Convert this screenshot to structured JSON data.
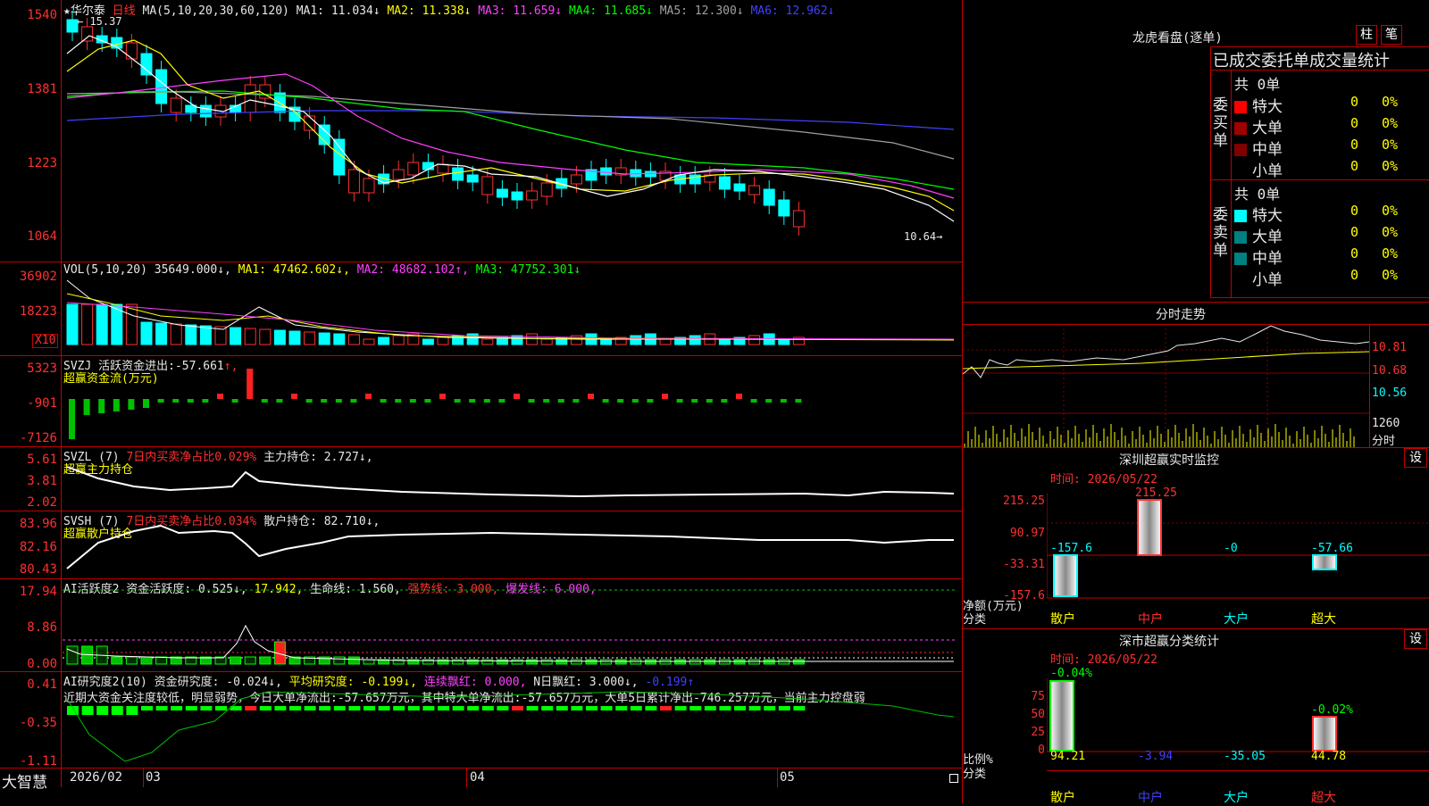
{
  "price_panel": {
    "axis": [
      "1540",
      "1381",
      "1223",
      "1064"
    ],
    "name": "★华尔泰",
    "period": "日线",
    "ma_label": "MA(5,10,20,30,60,120)",
    "ma": [
      {
        "label": "MA1:",
        "value": "11.034",
        "arrow": "↓",
        "color": "#e8e8e8"
      },
      {
        "label": "MA2:",
        "value": "11.338",
        "arrow": "↓",
        "color": "#ffff00"
      },
      {
        "label": "MA3:",
        "value": "11.659",
        "arrow": "↓",
        "color": "#ff40ff"
      },
      {
        "label": "MA4:",
        "value": "11.685",
        "arrow": "↓",
        "color": "#00ff00"
      },
      {
        "label": "MA5:",
        "value": "12.300",
        "arrow": "↓",
        "color": "#a0a0a0"
      },
      {
        "label": "MA6:",
        "value": "12.962",
        "arrow": "↓",
        "color": "#4040ff"
      }
    ],
    "high_mark": "15.37",
    "low_mark": "10.64"
  },
  "vol_panel": {
    "axis": [
      "36902",
      "18223"
    ],
    "unit": "X10",
    "label": "VOL(5,10,20)",
    "value": "35649.000↓,",
    "ma1": "MA1: 47462.602↓,",
    "ma2": "MA2: 48682.102↑,",
    "ma3": "MA3: 47752.301↓"
  },
  "svzj_panel": {
    "axis": [
      "5323",
      "-901",
      "-7126"
    ],
    "title": "SVZJ",
    "line1": "活跃资金进出:-57.661",
    "arrow": "↑,",
    "sub": "超赢资金流(万元)"
  },
  "svzl_panel": {
    "axis": [
      "5.61",
      "3.81",
      "2.02"
    ],
    "title": "SVZL (7)",
    "pct": "7日内买卖净占比0.029%",
    "main": "主力持仓: 2.727↓,",
    "sub": "超赢主力持仓"
  },
  "svsh_panel": {
    "axis": [
      "83.96",
      "82.16",
      "80.43"
    ],
    "title": "SVSH (7)",
    "pct": "7日内买卖净占比0.034%",
    "main": "散户持仓: 82.710↓,",
    "sub": "超赢散户持仓"
  },
  "ai_panel": {
    "axis": [
      "17.94",
      "8.86",
      "0.00"
    ],
    "title": "AI活跃度2",
    "f1": "资金活跃度: 0.525↓,",
    "f2": "17.942,",
    "f3": "生命线: 1.560,",
    "f4": "强势线: 3.000,",
    "f5": "爆发线: 6.000,"
  },
  "research_panel": {
    "axis": [
      "0.41",
      "-0.35",
      "-1.11"
    ],
    "title": "AI研究度2(10)",
    "f1": "资金研究度: -0.024↓,",
    "f2": "平均研究度: -0.199↓,",
    "f3": "连续飘红: 0.000,",
    "f4": "N日飘红: 3.000↓,",
    "f5": "-0.199↑",
    "note": "近期大资金关注度较低，明显弱势，今日大单净流出:-57.657万元，其中特大单净流出:-57.657万元，大单5日累计净出-746.257万元，当前主力控盘弱"
  },
  "timeline": {
    "logo": "大智慧",
    "labels": [
      "2026/02",
      "03",
      "04",
      "05"
    ]
  },
  "dragon_tiger": {
    "title": "龙虎看盘(逐单)",
    "btn1": "柱",
    "btn2": "笔",
    "header": "已成交委托单成交量统计",
    "buy_label": "委买单",
    "sell_label": "委卖单",
    "buy_count": "共 0单",
    "sell_count": "共 0单",
    "buy_rows": [
      {
        "name": "特大",
        "val": "0",
        "pct": "0%",
        "color": "#ff0000"
      },
      {
        "name": "大单",
        "val": "0",
        "pct": "0%",
        "color": "#a00000"
      },
      {
        "name": "中单",
        "val": "0",
        "pct": "0%",
        "color": "#800000"
      },
      {
        "name": "小单",
        "val": "0",
        "pct": "0%",
        "color": "#000000"
      }
    ],
    "sell_rows": [
      {
        "name": "特大",
        "val": "0",
        "pct": "0%",
        "color": "#00ffff"
      },
      {
        "name": "大单",
        "val": "0",
        "pct": "0%",
        "color": "#008080"
      },
      {
        "name": "中单",
        "val": "0",
        "pct": "0%",
        "color": "#008080"
      },
      {
        "name": "小单",
        "val": "0",
        "pct": "0%",
        "color": "#000000"
      }
    ]
  },
  "intraday": {
    "title": "分时走势",
    "price_axis": [
      "10.81",
      "10.68",
      "10.56"
    ],
    "vol_top": "1260",
    "vol_label": "分时"
  },
  "sz_monitor": {
    "title": "深圳超赢实时监控",
    "settings": "设",
    "date": "时间: 2026/05/22",
    "axis": [
      "215.25",
      "90.97",
      "-33.31",
      "-157.6"
    ],
    "ylabel": "净额(万元)",
    "xlabel": "分类",
    "categories": [
      "散户",
      "中户",
      "大户",
      "超大"
    ],
    "values": [
      "-157.6",
      "215.25",
      "-0",
      "-57.66"
    ]
  },
  "sz_class": {
    "title": "深市超赢分类统计",
    "settings": "设",
    "date": "时间: 2026/05/22",
    "axis": [
      "75",
      "50",
      "25",
      "0"
    ],
    "ylabel": "比例%",
    "xlabel": "分类",
    "categories": [
      "散户",
      "中户",
      "大户",
      "超大"
    ],
    "pct_top": [
      "-0.04%",
      "-0.02%"
    ],
    "values": [
      "94.21",
      "-3.94",
      "-35.05",
      "44.78"
    ]
  }
}
